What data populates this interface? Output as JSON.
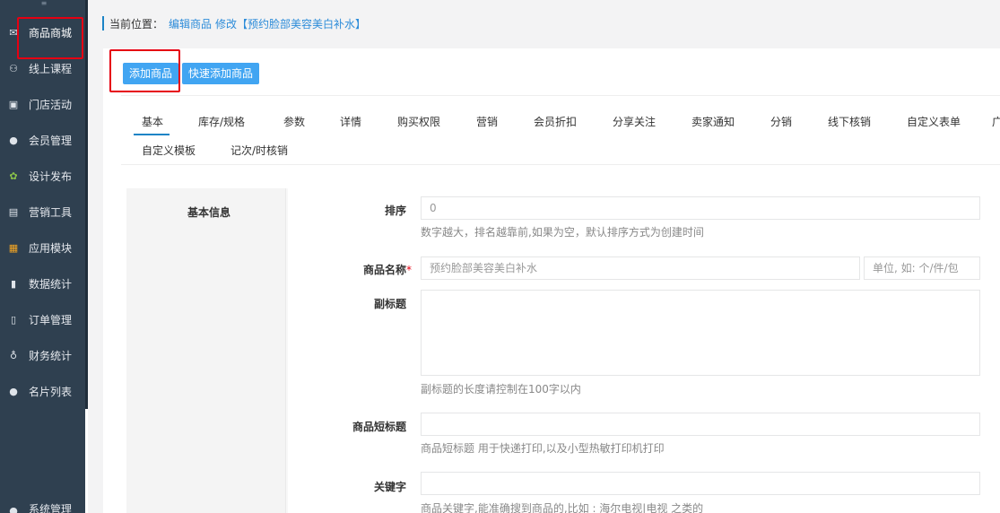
{
  "sidebar": {
    "top_icon": "≡",
    "items": [
      {
        "label": "商品商城",
        "icon": "mail-icon",
        "glyph": "✉"
      },
      {
        "label": "线上课程",
        "icon": "users-icon",
        "glyph": "⚇"
      },
      {
        "label": "门店活动",
        "icon": "store-icon",
        "glyph": "▣"
      },
      {
        "label": "会员管理",
        "icon": "user-icon",
        "glyph": "●"
      },
      {
        "label": "设计发布",
        "icon": "leaf-icon",
        "glyph": "✿"
      },
      {
        "label": "营销工具",
        "icon": "gift-icon",
        "glyph": "▤"
      },
      {
        "label": "应用模块",
        "icon": "grid-icon",
        "glyph": "▦"
      },
      {
        "label": "数据统计",
        "icon": "bar-chart-icon",
        "glyph": "▮"
      },
      {
        "label": "订单管理",
        "icon": "file-icon",
        "glyph": "▯"
      },
      {
        "label": "财务统计",
        "icon": "money-bag-icon",
        "glyph": "♁"
      },
      {
        "label": "名片列表",
        "icon": "card-user-icon",
        "glyph": "●"
      },
      {
        "label": "系统管理",
        "icon": "settings-user-icon",
        "glyph": "●"
      }
    ]
  },
  "breadcrumb": {
    "label": "当前位置：",
    "links": [
      "编辑商品",
      "修改【预约脸部美容美白补水】"
    ]
  },
  "toolbar": {
    "add_label": "添加商品",
    "quick_add_label": "快速添加商品"
  },
  "tabs": {
    "row1": [
      "基本",
      "库存/规格",
      "参数",
      "详情",
      "购买权限",
      "营销",
      "会员折扣",
      "分享关注",
      "卖家通知",
      "分销",
      "线下核销",
      "自定义表单",
      "广"
    ],
    "row2": [
      "自定义模板",
      "记次/时核销"
    ]
  },
  "form": {
    "section_title": "基本信息",
    "sort": {
      "label": "排序",
      "value": "0",
      "help": "数字越大，排名越靠前,如果为空，默认排序方式为创建时间"
    },
    "name": {
      "label": "商品名称",
      "required": "*",
      "value": "预约脸部美容美白补水",
      "unit_placeholder": "单位, 如: 个/件/包"
    },
    "subtitle": {
      "label": "副标题",
      "help": "副标题的长度请控制在100字以内"
    },
    "short_title": {
      "label": "商品短标题",
      "help": "商品短标题 用于快递打印,以及小型热敏打印机打印"
    },
    "keywords": {
      "label": "关键字",
      "help": "商品关键字,能准确搜到商品的,比如 : 海尔电视|电视 之类的"
    }
  },
  "colors": {
    "sidebar_bg": "#2f4050",
    "button_blue": "#41a5f2",
    "link_blue": "#2d8cd9",
    "highlight_red": "#e60012"
  }
}
